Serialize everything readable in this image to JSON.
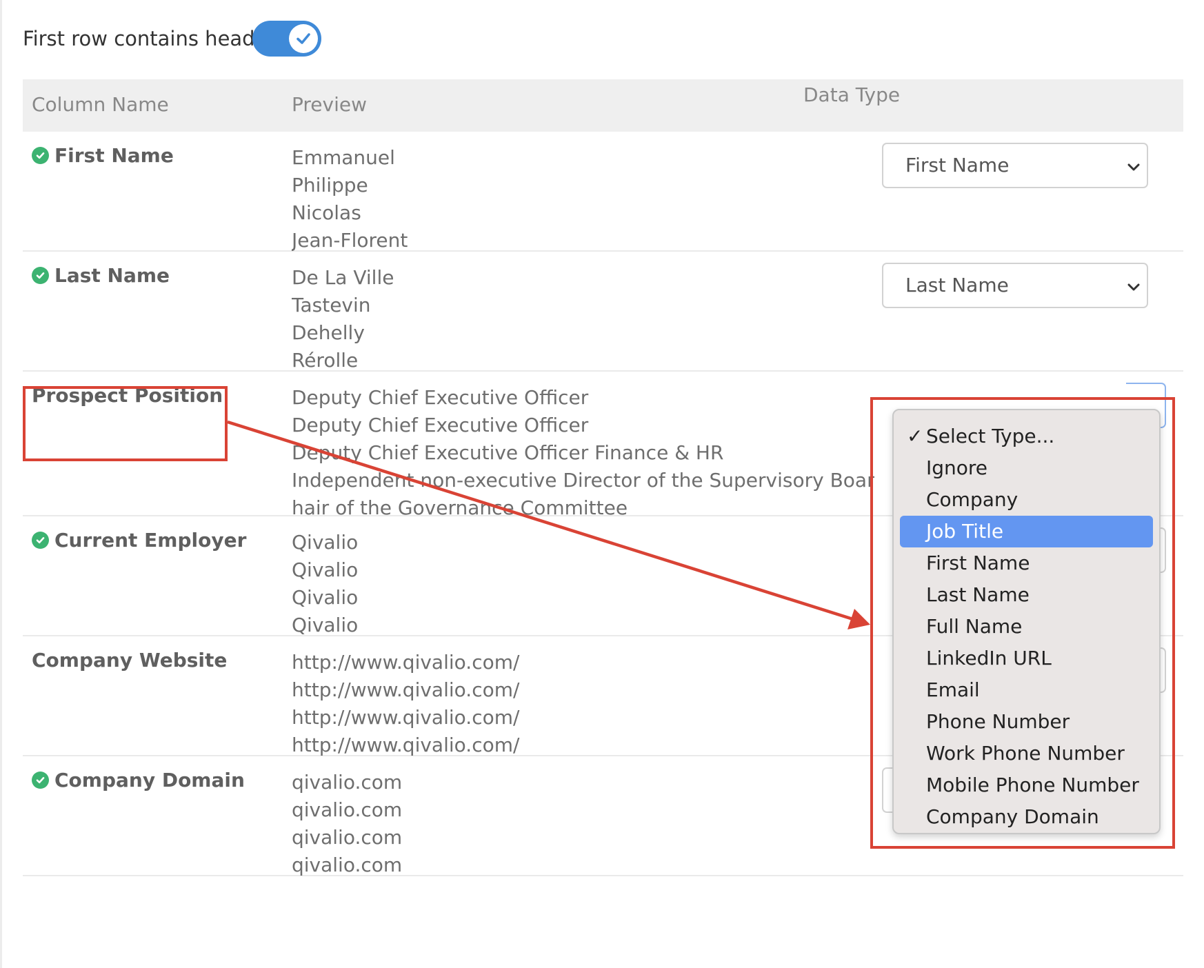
{
  "header_toggle": {
    "label": "First row contains header",
    "on": true
  },
  "table": {
    "headers": {
      "column_name": "Column Name",
      "preview": "Preview",
      "data_type": "Data Type"
    },
    "rows": [
      {
        "name": "First Name",
        "matched": true,
        "preview": [
          "Emmanuel",
          "Philippe",
          "Nicolas",
          "Jean-Florent"
        ],
        "data_type": "First Name"
      },
      {
        "name": "Last Name",
        "matched": true,
        "preview": [
          "De La Ville",
          "Tastevin",
          "Dehelly",
          "Rérolle"
        ],
        "data_type": "Last Name"
      },
      {
        "name": "Prospect Position",
        "matched": false,
        "preview": [
          "Deputy Chief Executive Officer",
          "Deputy Chief Executive Officer",
          "Deputy Chief Executive Officer Finance & HR",
          "Independent non-executive Director of the Supervisory Board, C",
          "hair of the Governance Committee"
        ],
        "data_type": "Select Type..."
      },
      {
        "name": "Current Employer",
        "matched": true,
        "preview": [
          "Qivalio",
          "Qivalio",
          "Qivalio",
          "Qivalio"
        ],
        "data_type": ""
      },
      {
        "name": "Company Website",
        "matched": false,
        "preview": [
          "http://www.qivalio.com/",
          "http://www.qivalio.com/",
          "http://www.qivalio.com/",
          "http://www.qivalio.com/"
        ],
        "data_type": ""
      },
      {
        "name": "Company Domain",
        "matched": true,
        "preview": [
          "qivalio.com",
          "qivalio.com",
          "qivalio.com",
          "qivalio.com"
        ],
        "data_type": "Company Domain"
      }
    ]
  },
  "dropdown": {
    "checked_option": "Select Type...",
    "highlighted_option": "Job Title",
    "options": [
      "Select Type...",
      "Ignore",
      "Company",
      "Job Title",
      "First Name",
      "Last Name",
      "Full Name",
      "LinkedIn URL",
      "Email",
      "Phone Number",
      "Work Phone Number",
      "Mobile Phone Number",
      "Company Domain"
    ]
  },
  "colors": {
    "toggle_on": "#3f8ad8",
    "check_green": "#3cb371",
    "menu_highlight": "#6396f1",
    "annotation_red": "#d94335",
    "header_bg": "#efefef"
  },
  "icons": {
    "toggle": "check-icon",
    "matched": "check-circle-icon",
    "select_arrow": "chevron-down-icon",
    "menu_checked": "checkmark-icon"
  }
}
